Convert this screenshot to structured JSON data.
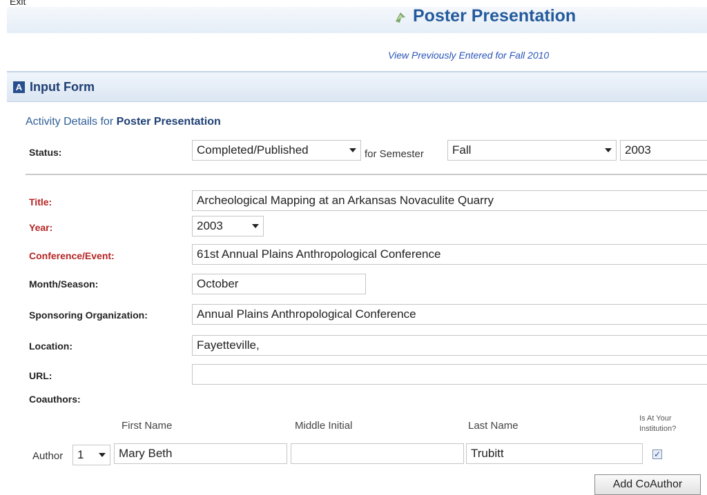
{
  "header": {
    "exit_label": "Exit",
    "title": "Poster Presentation",
    "view_link": "View Previously Entered for Fall 2010"
  },
  "section": {
    "badge": "A",
    "title": "Input Form",
    "details_prefix": "Activity Details for ",
    "details_activity": "Poster Presentation"
  },
  "status": {
    "label": "Status:",
    "value": "Completed/Published",
    "for_semester_label": "for Semester",
    "semester": "Fall",
    "year": "2003"
  },
  "fields": {
    "title_label": "Title:",
    "title_value": "Archeological Mapping at an Arkansas Novaculite Quarry",
    "year_label": "Year:",
    "year_value": "2003",
    "conference_label": "Conference/Event:",
    "conference_value": "61st Annual Plains Anthropological Conference",
    "month_label": "Month/Season:",
    "month_value": "October",
    "sponsor_label": "Sponsoring Organization:",
    "sponsor_value": "Annual Plains Anthropological Conference",
    "location_label": "Location:",
    "location_value": "Fayetteville,",
    "url_label": "URL:",
    "url_value": ""
  },
  "coauthors": {
    "label": "Coauthors:",
    "col_first": "First Name",
    "col_middle": "Middle Initial",
    "col_last": "Last Name",
    "col_institution_1": "Is At Your",
    "col_institution_2": "Institution?",
    "author_label": "Author",
    "author_number": "1",
    "first_name": "Mary Beth",
    "middle_initial": "",
    "last_name": "Trubitt",
    "at_institution_checked": true,
    "add_button": "Add CoAuthor"
  },
  "colors": {
    "title_blue": "#245a9c",
    "required_red": "#b52424",
    "link_blue": "#2a55b8"
  }
}
